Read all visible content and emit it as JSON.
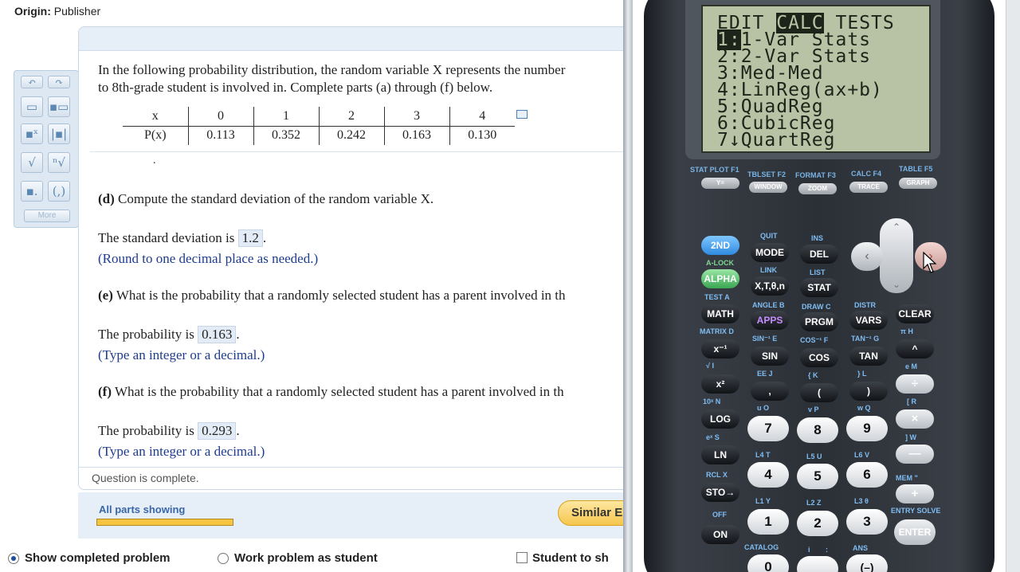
{
  "origin": {
    "label": "Origin:",
    "value": "Publisher"
  },
  "toolbar": {
    "more_label": "More"
  },
  "question": {
    "intro_line1": "In the following probability distribution, the random variable X represents the number",
    "intro_line2": "to 8th-grade student is involved in. Complete parts (a) through (f) below.",
    "table": {
      "x_label": "x",
      "p_label": "P(x)",
      "x_values": [
        "0",
        "1",
        "2",
        "3",
        "4"
      ],
      "p_values": [
        "0.113",
        "0.352",
        "0.242",
        "0.163",
        "0.130"
      ]
    },
    "dot": ".",
    "part_d": {
      "letter": "(d)",
      "text": "Compute the standard deviation of the random variable X.",
      "answer_prefix": "The standard deviation is",
      "answer": "1.2",
      "answer_suffix": ".",
      "hint": "(Round to one decimal place as needed.)"
    },
    "part_e": {
      "letter": "(e)",
      "text": "What is the probability that a randomly selected student has a parent involved in th",
      "answer_prefix": "The probability is",
      "answer": "0.163",
      "answer_suffix": ".",
      "hint": "(Type an integer or a decimal.)"
    },
    "part_f": {
      "letter": "(f)",
      "text": "What is the probability that a randomly selected student has a parent involved in th",
      "answer_prefix": "The probability is",
      "answer": "0.293",
      "answer_suffix": ".",
      "hint": "(Type an integer or a decimal.)"
    },
    "status": "Question is complete."
  },
  "progress": {
    "label": "All parts showing",
    "fraction": 1.0
  },
  "similar_button": "Similar E",
  "bottom_options": {
    "show_completed": "Show completed problem",
    "work_as_student": "Work problem as student",
    "student_to": "Student to sh"
  },
  "calculator": {
    "lcd": {
      "menu_edit": "EDIT",
      "menu_calc": "CALC",
      "menu_tests": "TESTS",
      "item1_num": "1:",
      "item1_text": "1-Var Stats",
      "item2": "2:2-Var Stats",
      "item3": "3:Med-Med",
      "item4": "4:LinReg(ax+b)",
      "item5": "5:QuadReg",
      "item6": "6:CubicReg",
      "item7": "7↓QuartReg"
    },
    "fkeys": [
      {
        "top": "STAT PLOT F1",
        "key": "Y="
      },
      {
        "top": "TBLSET F2",
        "key": "WINDOW"
      },
      {
        "top": "FORMAT F3",
        "key": "ZOOM"
      },
      {
        "top": "CALC F4",
        "key": "TRACE"
      },
      {
        "top": "TABLE F5",
        "key": "GRAPH"
      }
    ],
    "keys": {
      "k2nd": "2ND",
      "mode": "MODE",
      "del": "DEL",
      "alpha": "ALPHA",
      "xton": "X,T,θ,n",
      "stat": "STAT",
      "math": "MATH",
      "apps": "APPS",
      "prgm": "PRGM",
      "vars": "VARS",
      "clear": "CLEAR",
      "xinv": "x⁻¹",
      "sin": "SIN",
      "cos": "COS",
      "tan": "TAN",
      "caret": "^",
      "xsq": "x²",
      "comma": ",",
      "lparen": "(",
      "rparen": ")",
      "div": "÷",
      "log": "LOG",
      "k7": "7",
      "k8": "8",
      "k9": "9",
      "mul": "×",
      "ln": "LN",
      "k4": "4",
      "k5": "5",
      "k6": "6",
      "minus": "—",
      "sto": "STO→",
      "k1": "1",
      "k2": "2",
      "k3": "3",
      "plus": "+",
      "on": "ON",
      "k0": "0",
      "neg": "(–)",
      "enter": "ENTER"
    },
    "secondary": {
      "quit": "QUIT",
      "ins": "INS",
      "alock": "A-LOCK",
      "link": "LINK",
      "list": "LIST",
      "test_a": "TEST  A",
      "angle_b": "ANGLE  B",
      "draw_c": "DRAW  C",
      "distr": "DISTR",
      "matrix_d": "MATRIX  D",
      "sin1_e": "SIN⁻¹  E",
      "cos1_f": "COS⁻¹  F",
      "tan1_g": "TAN⁻¹  G",
      "pi_h": "π  H",
      "sqrt_i": "√  I",
      "ee_j": "EE  J",
      "k_l": "{  K",
      "l_l": "}  L",
      "e_m": "e  M",
      "tenx_n": "10ˣ  N",
      "u_o": "u  O",
      "v_p": "v  P",
      "w_q": "w  Q",
      "r": "[  R",
      "ex_s": "eˣ  S",
      "l4_t": "L4  T",
      "l5_u": "L5  U",
      "l6_v": "L6  V",
      "w": "]  W",
      "rcl_x": "RCL  X",
      "l1_y": "L1  Y",
      "l2_z": "L2  Z",
      "l3": "L3  θ",
      "mem": "MEM  \"",
      "off": "OFF",
      "catalog": "CATALOG",
      "i": "i",
      "colon": ":",
      "ans": "ANS",
      "entry": "ENTRY SOLVE"
    }
  }
}
